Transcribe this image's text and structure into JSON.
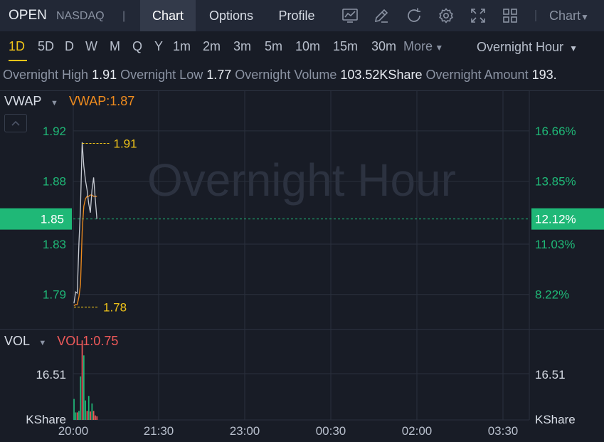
{
  "header": {
    "ticker": "OPEN",
    "exchange": "NASDAQ",
    "separator": "|",
    "tabs": [
      {
        "label": "Chart",
        "active": true
      },
      {
        "label": "Options",
        "active": false
      },
      {
        "label": "Profile",
        "active": false
      }
    ],
    "toolbar_icons": [
      "line-chart-icon",
      "draw-pen-icon",
      "refresh-icon",
      "settings-gear-icon",
      "fullscreen-icon",
      "grid-layout-icon"
    ],
    "chart_type_label": "Chart"
  },
  "periods": {
    "items": [
      "1D",
      "5D",
      "D",
      "W",
      "M",
      "Q",
      "Y",
      "1m",
      "2m",
      "3m",
      "5m",
      "10m",
      "15m",
      "30m"
    ],
    "active": "1D",
    "more_label": "More",
    "session_label": "Overnight Hour"
  },
  "stats": {
    "high_label": "Overnight High",
    "high_value": "1.91",
    "low_label": "Overnight Low",
    "low_value": "1.77",
    "volume_label": "Overnight Volume",
    "volume_value": "103.52KShare",
    "amount_label": "Overnight Amount",
    "amount_value": "193."
  },
  "price_panel": {
    "indicator_name": "VWAP",
    "indicator_value": "VWAP:1.87",
    "watermark": "Overnight Hour",
    "current_price": "1.85",
    "current_pct": "12.12%",
    "high_marker": "1.91",
    "low_marker": "1.78"
  },
  "volume_panel": {
    "indicator_name": "VOL",
    "indicator_value": "VOL1:0.75",
    "left_labels": [
      "16.51",
      "KShare"
    ],
    "right_labels": [
      "16.51",
      "KShare"
    ]
  },
  "colors": {
    "up": "#1fb877",
    "down": "#f05a5a",
    "vwap": "#f08c1e",
    "marker": "#f0c419",
    "price_line": "#c8ccd4"
  },
  "chart_data": {
    "type": "line",
    "x_ticks": [
      "20:00",
      "21:30",
      "23:00",
      "00:30",
      "02:00",
      "03:30"
    ],
    "y_ticks": [
      1.79,
      1.83,
      1.88,
      1.92
    ],
    "y_ticks_pct": [
      "8.22%",
      "11.03%",
      "13.85%",
      "16.66%"
    ],
    "ylim": [
      1.774,
      1.944
    ],
    "grid": true,
    "series": [
      {
        "name": "VWAP",
        "minutes": [
          0,
          1,
          2,
          3,
          4,
          5,
          6,
          7,
          8,
          9,
          10,
          11,
          12,
          13,
          14
        ],
        "values": [
          1.781,
          1.782,
          1.782,
          1.788,
          1.798,
          1.84,
          1.86,
          1.866,
          1.868,
          1.868,
          1.869,
          1.869,
          1.868,
          1.868,
          1.868
        ]
      },
      {
        "minutes": [
          0,
          1,
          2,
          3,
          4,
          5,
          6,
          7,
          8,
          9,
          10,
          11,
          12,
          13,
          14
        ],
        "values": [
          1.783,
          1.792,
          1.791,
          1.83,
          1.86,
          1.911,
          1.892,
          1.881,
          1.873,
          1.862,
          1.855,
          1.873,
          1.883,
          1.866,
          1.85
        ]
      }
    ],
    "volume": {
      "minutes": [
        0,
        1,
        2,
        3,
        4,
        5,
        6,
        7,
        8,
        9,
        10,
        11,
        12,
        13,
        14
      ],
      "values": [
        7.0,
        2.5,
        2.5,
        3.0,
        14.5,
        26.5,
        21.5,
        6.5,
        3.0,
        8.0,
        2.8,
        5.5,
        3.0,
        1.5,
        1.2
      ],
      "direction": [
        "up",
        "up",
        "down",
        "up",
        "up",
        "down",
        "up",
        "up",
        "down",
        "up",
        "down",
        "up",
        "down",
        "down",
        "down"
      ]
    }
  }
}
